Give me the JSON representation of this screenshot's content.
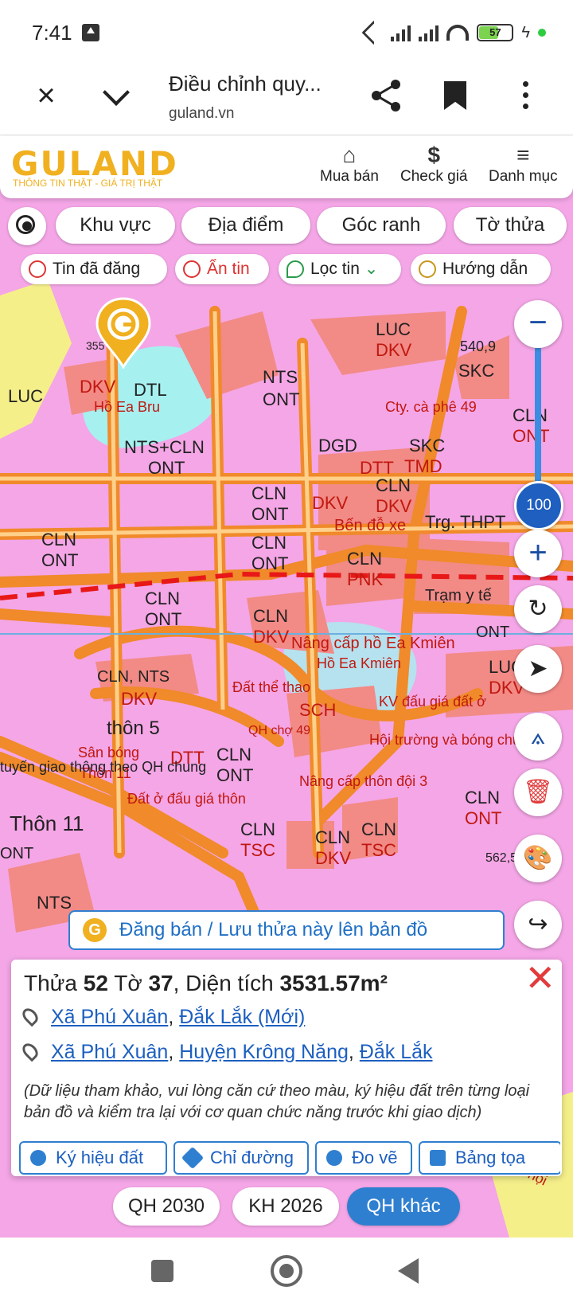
{
  "status": {
    "time": "7:41",
    "battery": "57"
  },
  "browser": {
    "title": "Điều chỉnh quy...",
    "url": "guland.vn"
  },
  "header": {
    "logo": "GULAND",
    "tagline": "THÔNG TIN THẬT - GIÁ TRỊ THẬT",
    "nav": [
      "Mua bán",
      "Check giá",
      "Danh mục"
    ],
    "check_price_icon": "$"
  },
  "chips": {
    "row1": [
      "Khu vực",
      "Địa điểm",
      "Góc ranh",
      "Tờ thửa"
    ],
    "row2": [
      "Tin đã đăng",
      "Ẩn tin",
      "Lọc tin",
      "Hướng dẫn"
    ]
  },
  "map": {
    "zoom": "100",
    "labels": [
      "DKV",
      "DTL",
      "Hồ Ea Bru",
      "LUC",
      "NTS",
      "ONT",
      "LUC",
      "DKV",
      "540,9",
      "SKC",
      "Cty. cà phê 49",
      "CLN",
      "ONT",
      "NTS+CLN",
      "ONT",
      "DGD",
      "SKC",
      "TMD",
      "DTT",
      "CLN",
      "ONT",
      "DKV",
      "CLN",
      "DKV",
      "Bến đỗ xe",
      "Trg. THPT",
      "CLN",
      "ONT",
      "CLN",
      "ONT",
      "CLN",
      "PNK",
      "Trạm y tế",
      "CLN",
      "ONT",
      "CLN",
      "DKV",
      "Nâng cấp hồ Ea Kmiên",
      "Hồ Ea Kmiên",
      "ONT",
      "LUC",
      "DKV",
      "CLN, NTS",
      "DKV",
      "Đất thể thao",
      "SCH",
      "KV đấu giá đất ở",
      "thôn 5",
      "QH chợ 49",
      "Hội trường và bóng chuyền",
      "Sân bóng",
      "Thôn 11",
      "DTT",
      "CLN",
      "ONT",
      "Nâng cấp thôn đội 3",
      "Đất ở đấu giá thôn",
      "CLN",
      "ONT",
      "Thôn 11",
      "CLN",
      "TSC",
      "CLN",
      "DKV",
      "CLN",
      "TSC",
      "ONT",
      "562,5",
      "tuyến giao thông theo QH chung",
      "NTS",
      "Đất hội",
      "353,7 tr/m²",
      "355"
    ]
  },
  "post_bar": "Đăng bán / Lưu thửa này lên bản đồ",
  "parcel": {
    "prefix_thua": "Thửa",
    "thua": "52",
    "prefix_to": "Tờ",
    "to": "37",
    "prefix_area": ", Diện tích",
    "area": "3531.57m²",
    "address_new": {
      "commune": "Xã Phú Xuân",
      "province": "Đắk Lắk (Mới)"
    },
    "address_old": {
      "commune": "Xã Phú Xuân",
      "district": "Huyện Krông Năng",
      "province": "Đắk Lắk"
    },
    "note": "(Dữ liệu tham khảo, vui lòng căn cứ theo màu, ký hiệu đất trên từng loại bản đồ và kiểm tra lại với cơ quan chức năng trước khi giao dịch)",
    "actions": [
      "Ký hiệu đất",
      "Chỉ đường",
      "Đo vẽ",
      "Bảng tọa"
    ]
  },
  "plan_tabs": [
    "QH 2030",
    "KH 2026",
    "QH khác"
  ],
  "colors": {
    "accent": "#2f7fd0",
    "brand": "#f0b020",
    "map_pink": "#f4a6e6",
    "road": "#f08a2a",
    "close": "#e23b3b"
  }
}
